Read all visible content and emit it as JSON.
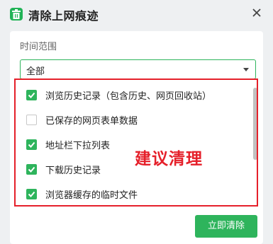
{
  "window": {
    "title": "清除上网痕迹",
    "app_icon": "trash-bin-icon",
    "close_icon": "close-icon"
  },
  "time_range": {
    "label": "时间范围",
    "selected": "全部"
  },
  "items": [
    {
      "label": "浏览历史记录（包含历史、网页回收站）",
      "checked": true
    },
    {
      "label": "已保存的网页表单数据",
      "checked": false
    },
    {
      "label": "地址栏下拉列表",
      "checked": true
    },
    {
      "label": "下载历史记录",
      "checked": true
    },
    {
      "label": "浏览器缓存的临时文件",
      "checked": true
    }
  ],
  "annotation": {
    "text": "建议清理",
    "color": "#e5202a"
  },
  "actions": {
    "clear_now_label": "立即清除"
  },
  "colors": {
    "accent": "#2eb45c",
    "highlight": "#e5202a"
  }
}
